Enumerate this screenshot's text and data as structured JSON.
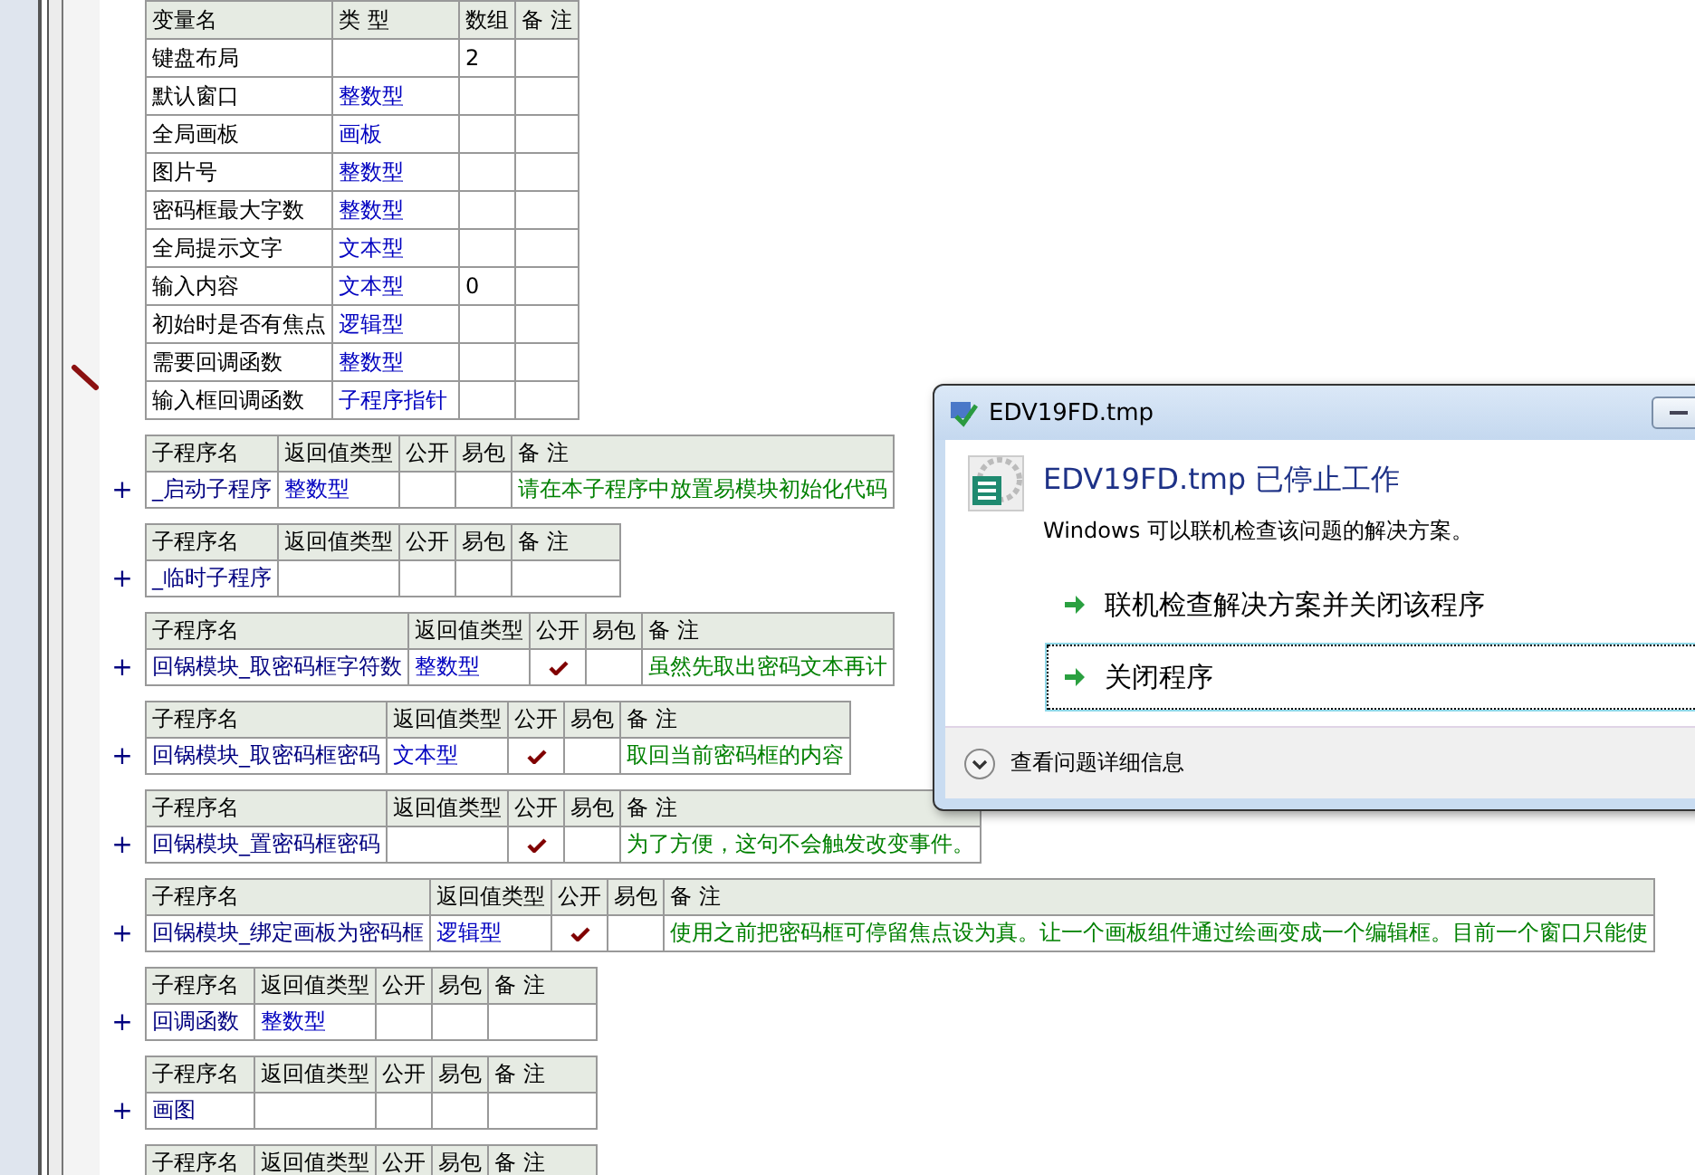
{
  "variables": {
    "headers": [
      "变量名",
      "类 型",
      "数组",
      "备 注"
    ],
    "rows": [
      {
        "name": "键盘布局",
        "array": "2"
      },
      {
        "name": "默认窗口",
        "type": "整数型"
      },
      {
        "name": "全局画板",
        "type": "画板"
      },
      {
        "name": "图片号",
        "type": "整数型"
      },
      {
        "name": "密码框最大字数",
        "type": "整数型"
      },
      {
        "name": "全局提示文字",
        "type": "文本型"
      },
      {
        "name": "输入内容",
        "type": "文本型",
        "array": "0"
      },
      {
        "name": "初始时是否有焦点",
        "type": "逻辑型"
      },
      {
        "name": "需要回调函数",
        "type": "整数型"
      },
      {
        "name": "输入框回调函数",
        "type": "子程序指针"
      }
    ]
  },
  "subprograms": [
    {
      "headers": [
        "子程序名",
        "返回值类型",
        "公开",
        "易包",
        "备 注"
      ],
      "expand": "+",
      "name": "_启动子程序",
      "return_type": "整数型",
      "public": false,
      "note": "请在本子程序中放置易模块初始化代码"
    },
    {
      "headers": [
        "子程序名",
        "返回值类型",
        "公开",
        "易包",
        "备 注"
      ],
      "expand": "+",
      "name": "_临时子程序",
      "public": false
    },
    {
      "headers": [
        "子程序名",
        "返回值类型",
        "公开",
        "易包",
        "备 注"
      ],
      "expand": "+",
      "name": "回锅模块_取密码框字符数",
      "return_type": "整数型",
      "public": true,
      "note": "虽然先取出密码文本再计"
    },
    {
      "headers": [
        "子程序名",
        "返回值类型",
        "公开",
        "易包",
        "备 注"
      ],
      "expand": "+",
      "name": "回锅模块_取密码框密码",
      "return_type": "文本型",
      "public": true,
      "note": "取回当前密码框的内容"
    },
    {
      "headers": [
        "子程序名",
        "返回值类型",
        "公开",
        "易包",
        "备 注"
      ],
      "expand": "+",
      "name": "回锅模块_置密码框密码",
      "public": true,
      "note": "为了方便，这句不会触发改变事件。"
    },
    {
      "headers": [
        "子程序名",
        "返回值类型",
        "公开",
        "易包",
        "备 注"
      ],
      "expand": "+",
      "name": "回锅模块_绑定画板为密码框",
      "return_type": "逻辑型",
      "public": true,
      "note": "使用之前把密码框可停留焦点设为真。让一个画板组件通过绘画变成一个编辑框。目前一个窗口只能使"
    },
    {
      "headers": [
        "子程序名",
        "返回值类型",
        "公开",
        "易包",
        "备 注"
      ],
      "expand": "+",
      "name": "回调函数",
      "return_type": "整数型",
      "public": false
    },
    {
      "headers": [
        "子程序名",
        "返回值类型",
        "公开",
        "易包",
        "备 注"
      ],
      "expand": "+",
      "name": "画图",
      "public": false
    },
    {
      "headers": [
        "子程序名",
        "返回值类型",
        "公开",
        "易包",
        "备 注"
      ]
    }
  ],
  "dialog": {
    "title": "EDV19FD.tmp",
    "heading": "EDV19FD.tmp 已停止工作",
    "message": "Windows 可以联机检查该问题的解决方案。",
    "options": [
      {
        "label": "联机检查解决方案并关闭该程序",
        "selected": false
      },
      {
        "label": "关闭程序",
        "selected": true
      }
    ],
    "details": "查看问题详细信息"
  }
}
